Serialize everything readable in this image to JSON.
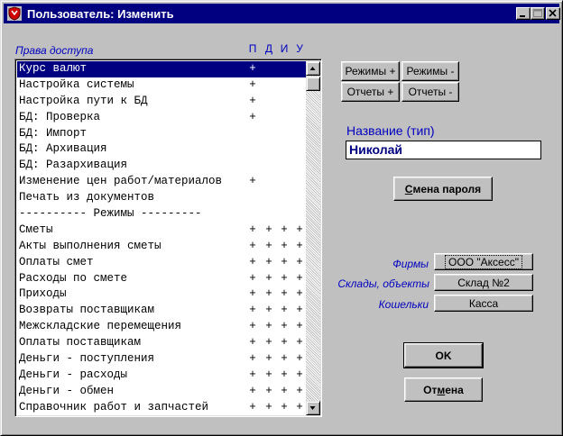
{
  "window": {
    "title": "Пользователь: Изменить",
    "app_icon": "shield-icon"
  },
  "access": {
    "title": "Права доступа",
    "columns": [
      "П",
      "Д",
      "И",
      "У"
    ],
    "rows": [
      {
        "label": "Курс валют",
        "perms": [
          "+",
          "",
          "",
          ""
        ],
        "selected": true
      },
      {
        "label": "Настройка системы",
        "perms": [
          "+",
          "",
          "",
          ""
        ]
      },
      {
        "label": "Настройка пути к БД",
        "perms": [
          "+",
          "",
          "",
          ""
        ]
      },
      {
        "label": "БД: Проверка",
        "perms": [
          "+",
          "",
          "",
          ""
        ]
      },
      {
        "label": "БД: Импорт",
        "perms": [
          "",
          "",
          "",
          ""
        ]
      },
      {
        "label": "БД: Архивация",
        "perms": [
          "",
          "",
          "",
          ""
        ]
      },
      {
        "label": "БД: Разархивация",
        "perms": [
          "",
          "",
          "",
          ""
        ]
      },
      {
        "label": "Изменение цен работ/материалов",
        "perms": [
          "+",
          "",
          "",
          ""
        ]
      },
      {
        "label": "Печать из документов",
        "perms": [
          "",
          "",
          "",
          ""
        ]
      },
      {
        "label": "----------  Режимы  ---------",
        "perms": [
          "",
          "",
          "",
          ""
        ]
      },
      {
        "label": "Сметы",
        "perms": [
          "+",
          "+",
          "+",
          "+"
        ]
      },
      {
        "label": "Акты выполнения сметы",
        "perms": [
          "+",
          "+",
          "+",
          "+"
        ]
      },
      {
        "label": "Оплаты смет",
        "perms": [
          "+",
          "+",
          "+",
          "+"
        ]
      },
      {
        "label": "Расходы по смете",
        "perms": [
          "+",
          "+",
          "+",
          "+"
        ]
      },
      {
        "label": "Приходы",
        "perms": [
          "+",
          "+",
          "+",
          "+"
        ]
      },
      {
        "label": "Возвраты поставщикам",
        "perms": [
          "+",
          "+",
          "+",
          "+"
        ]
      },
      {
        "label": "Межскладские перемещения",
        "perms": [
          "+",
          "+",
          "+",
          "+"
        ]
      },
      {
        "label": "Оплаты поставщикам",
        "perms": [
          "+",
          "+",
          "+",
          "+"
        ]
      },
      {
        "label": "Деньги - поступления",
        "perms": [
          "+",
          "+",
          "+",
          "+"
        ]
      },
      {
        "label": "Деньги - расходы",
        "perms": [
          "+",
          "+",
          "+",
          "+"
        ]
      },
      {
        "label": "Деньги - обмен",
        "perms": [
          "+",
          "+",
          "+",
          "+"
        ]
      },
      {
        "label": "Справочник работ и запчастей",
        "perms": [
          "+",
          "+",
          "+",
          "+"
        ]
      }
    ]
  },
  "buttons": {
    "modes_plus": "Режимы +",
    "modes_minus": "Режимы -",
    "reports_plus": "Отчеты +",
    "reports_minus": "Отчеты -",
    "change_password_u": "С",
    "change_password_rest": "мена пароля",
    "ok": "OK",
    "cancel_pre": "От",
    "cancel_u": "м",
    "cancel_post": "ена"
  },
  "name": {
    "label": "Название (тип)",
    "value": "Николай"
  },
  "links": {
    "firms_label": "Фирмы",
    "firms_value": "ООО \"Аксесс\"",
    "warehouses_label": "Склады, объекты",
    "warehouses_value": "Склад №2",
    "wallets_label": "Кошельки",
    "wallets_value": "Касса"
  },
  "colors": {
    "title_bg": "#000080",
    "accent_blue": "#0000c0",
    "face": "#c0c0c0"
  }
}
